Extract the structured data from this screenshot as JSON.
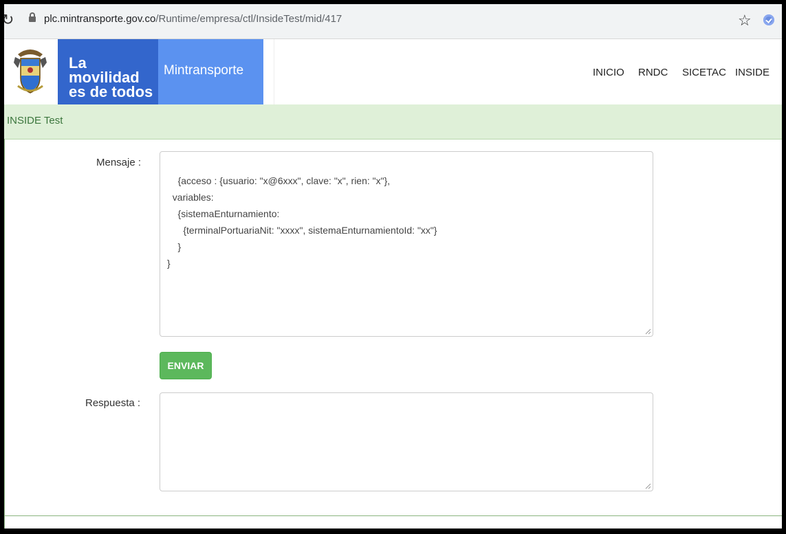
{
  "browser": {
    "url_host": "plc.mintransporte.gov.co",
    "url_path": "/Runtime/empresa/ctl/InsideTest/mid/417"
  },
  "header": {
    "brand_line1": "La movilidad",
    "brand_line2": "es de todos",
    "ministry": "Mintransporte",
    "nav": [
      "INICIO",
      "RNDC",
      "SICETAC",
      "INSIDE"
    ]
  },
  "page": {
    "title": "INSIDE Test"
  },
  "form": {
    "mensaje_label": "Mensaje :",
    "mensaje_value": "{acceso : {usuario: \"x@6xxx\", clave: \"x\", rien: \"x\"},\n  variables:\n    {sistemaEnturnamiento:\n      {terminalPortuariaNit: \"xxxx\", sistemaEnturnamientoId: \"xx\"}\n    }\n}",
    "send_label": "ENVIAR",
    "respuesta_label": "Respuesta :",
    "respuesta_value": ""
  },
  "colors": {
    "brand_blue": "#3366cc",
    "ministry_blue": "#5b92f0",
    "success_green": "#5cb85c",
    "title_bg": "#dff0d8"
  }
}
